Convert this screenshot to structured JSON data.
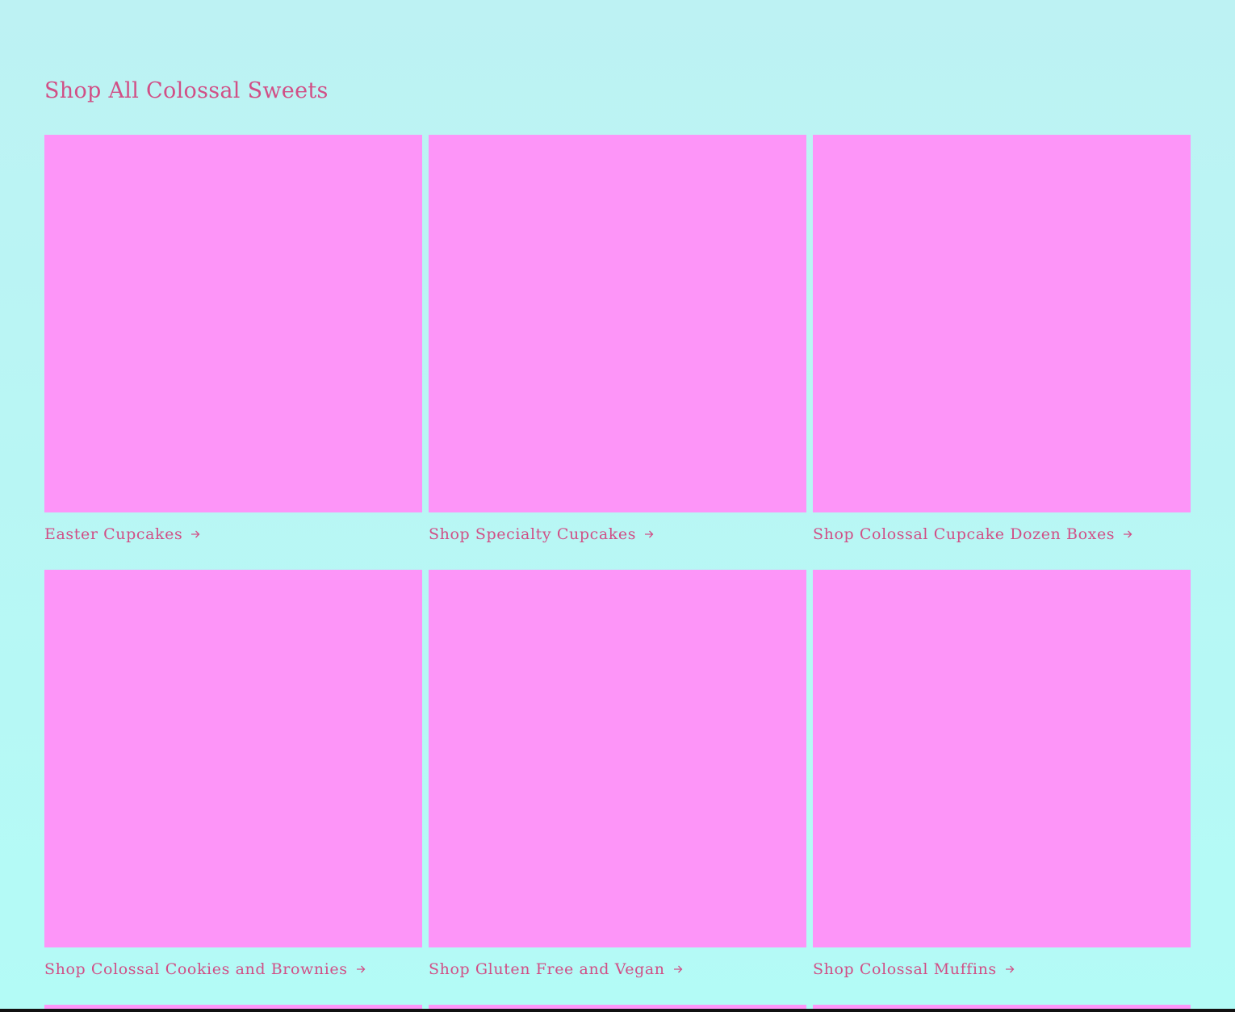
{
  "section": {
    "title": "Shop All Colossal Sweets"
  },
  "collections": [
    {
      "label": "Easter Cupcakes"
    },
    {
      "label": "Shop Specialty Cupcakes"
    },
    {
      "label": "Shop Colossal Cupcake Dozen Boxes"
    },
    {
      "label": "Shop Colossal Cookies and Brownies"
    },
    {
      "label": "Shop Gluten Free and Vegan"
    },
    {
      "label": "Shop Colossal Muffins"
    }
  ],
  "icons": {
    "card_arrow": "arrow-right-icon"
  },
  "colors": {
    "background": "#b8f6f4",
    "accent_text": "#d14f86",
    "image_placeholder": "#fd95f8"
  }
}
